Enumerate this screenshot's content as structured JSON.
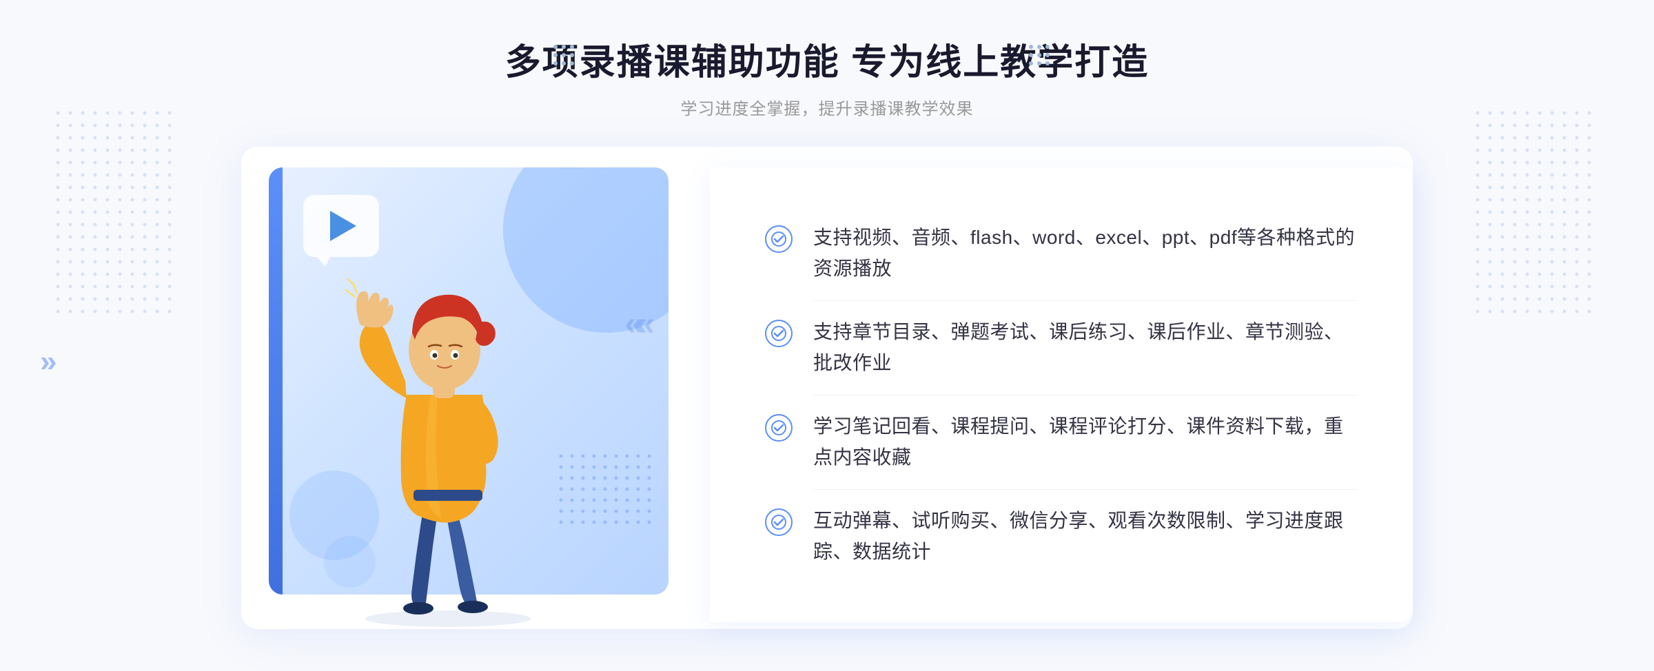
{
  "header": {
    "title": "多项录播课辅助功能 专为线上教学打造",
    "subtitle": "学习进度全掌握，提升录播课教学效果"
  },
  "features": [
    {
      "id": "feature-1",
      "text": "支持视频、音频、flash、word、excel、ppt、pdf等各种格式的资源播放"
    },
    {
      "id": "feature-2",
      "text": "支持章节目录、弹题考试、课后练习、课后作业、章节测验、批改作业"
    },
    {
      "id": "feature-3",
      "text": "学习笔记回看、课程提问、课程评论打分、课件资料下载，重点内容收藏"
    },
    {
      "id": "feature-4",
      "text": "互动弹幕、试听购买、微信分享、观看次数限制、学习进度跟踪、数据统计"
    }
  ],
  "colors": {
    "primary": "#5b8ff9",
    "title": "#1a1a2e",
    "text": "#333344",
    "subtitle": "#999999",
    "bg": "#f5f7fc"
  },
  "decorations": {
    "left_arrow": "»",
    "check_symbol": "✓"
  }
}
